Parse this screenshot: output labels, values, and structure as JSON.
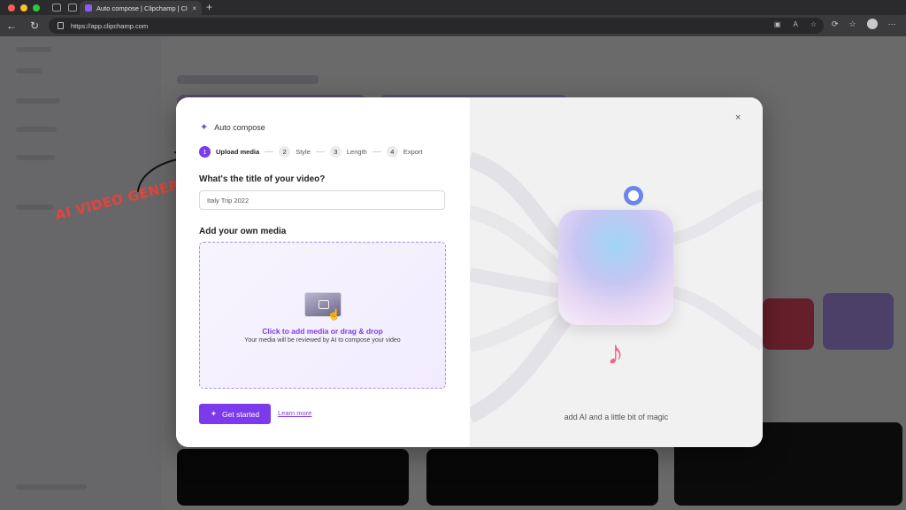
{
  "browser": {
    "tab_title": "Auto compose | Clipchamp | Cli",
    "tab_close": "×",
    "new_tab": "+",
    "url": "https://app.clipchamp.com"
  },
  "annotation": {
    "text": "AI VIDEO GENERATE"
  },
  "modal": {
    "title": "Auto compose",
    "steps": [
      {
        "num": "1",
        "label": "Upload media"
      },
      {
        "num": "2",
        "label": "Style"
      },
      {
        "num": "3",
        "label": "Length"
      },
      {
        "num": "4",
        "label": "Export"
      }
    ],
    "title_question": "What's the title of your video?",
    "title_value": "Italy Trip 2022",
    "media_heading": "Add your own media",
    "dropzone_main": "Click to add media or drag & drop",
    "dropzone_sub": "Your media will be reviewed by AI to compose your video",
    "primary_button": "Get started",
    "secondary_link": "Learn more",
    "close": "×",
    "illustration_caption": "add AI and a little bit of magic"
  },
  "colors": {
    "accent": "#7c3aed",
    "annotation": "#e8423b"
  }
}
